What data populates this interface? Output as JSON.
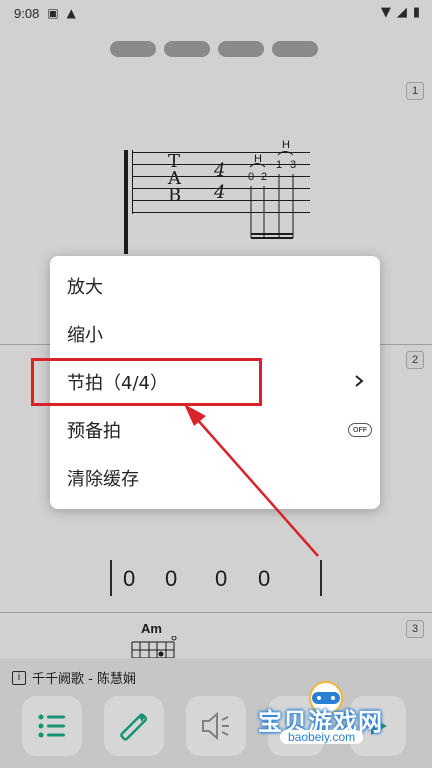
{
  "status_bar": {
    "time": "9:08"
  },
  "score": {
    "measure_numbers": [
      "1",
      "2",
      "3"
    ],
    "tab_letters": [
      "T",
      "A",
      "B"
    ],
    "time_signature": {
      "top": "4",
      "bottom": "4"
    },
    "notes": {
      "hammer_1": "H",
      "hammer_2": "H",
      "fret_a": "0",
      "fret_b": "2",
      "fret_c": "1",
      "fret_d": "3"
    },
    "beat_counts": [
      "0",
      "0",
      "0",
      "0"
    ],
    "chord": "Am"
  },
  "menu": {
    "items": [
      {
        "label": "放大"
      },
      {
        "label": "缩小"
      },
      {
        "label": "节拍（4/4）"
      },
      {
        "label": "预备拍",
        "toggle": "OFF"
      },
      {
        "label": "清除缓存"
      }
    ]
  },
  "bottom_bar": {
    "song_title": "千千阙歌 - 陈慧娴",
    "info_icon_glyph": "i"
  },
  "watermark": {
    "brand": "宝贝游戏网",
    "url": "baobeiy.com"
  },
  "colors": {
    "highlight": "#d9232b",
    "accent_green": "#1bb08a",
    "watermark_blue": "#2a7fd4"
  }
}
